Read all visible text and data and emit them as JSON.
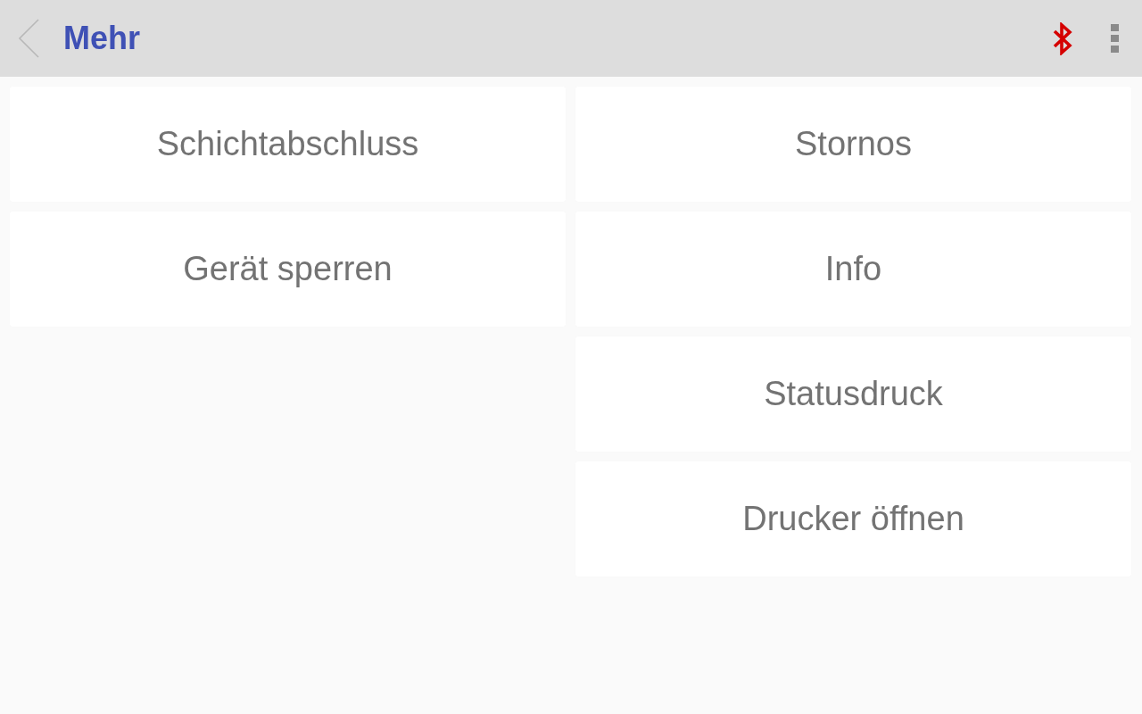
{
  "header": {
    "title": "Mehr"
  },
  "columns": [
    {
      "buttons": [
        {
          "label": "Schichtabschluss"
        },
        {
          "label": "Gerät sperren"
        }
      ]
    },
    {
      "buttons": [
        {
          "label": "Stornos"
        },
        {
          "label": "Info"
        },
        {
          "label": "Statusdruck"
        },
        {
          "label": "Drucker öffnen"
        }
      ]
    }
  ]
}
